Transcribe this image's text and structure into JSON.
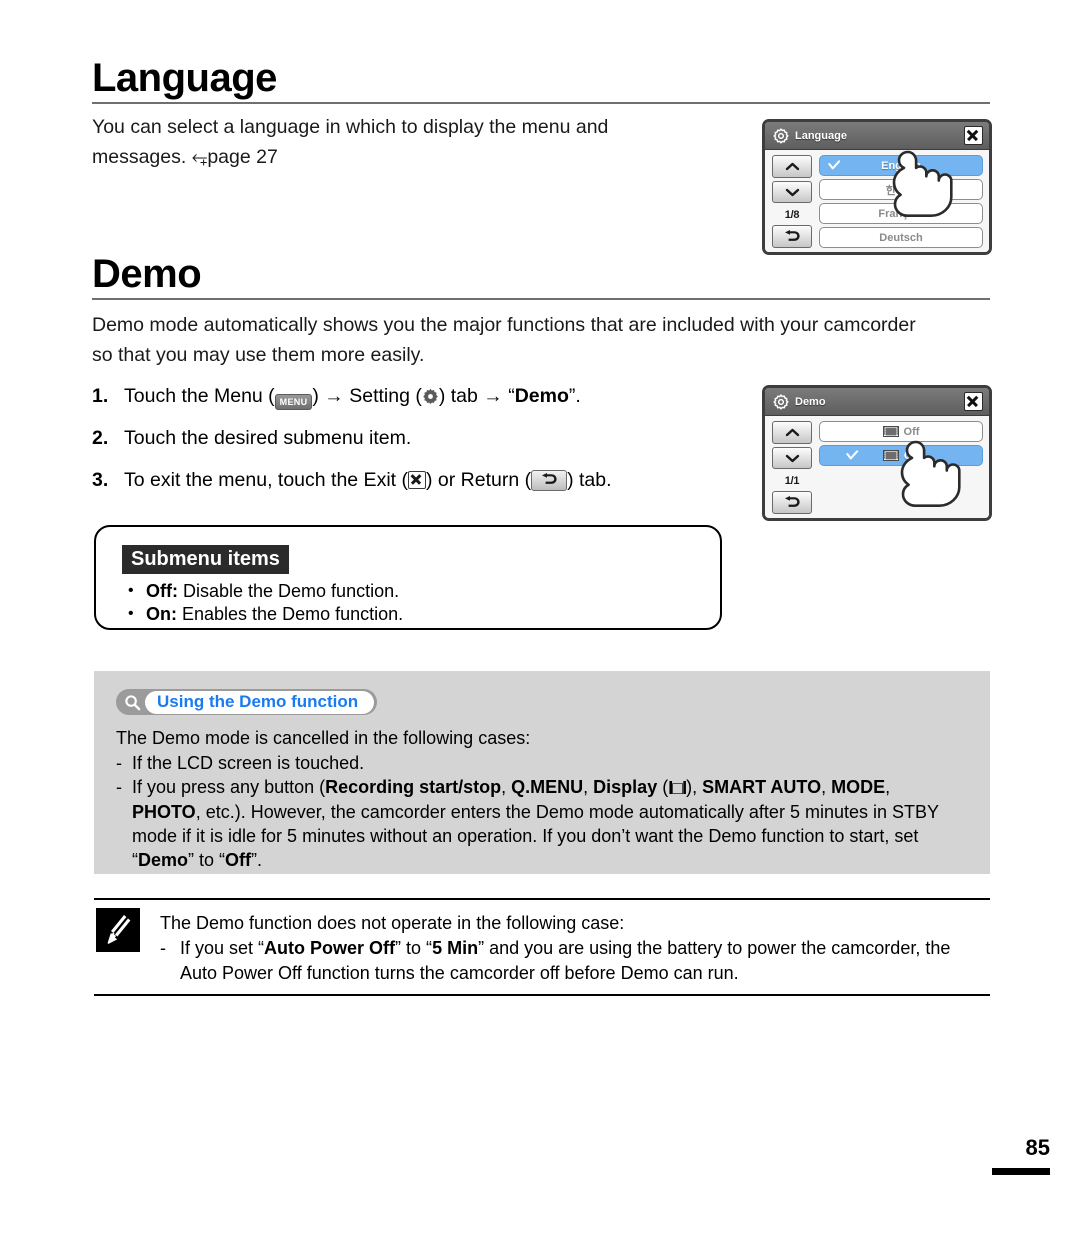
{
  "page": {
    "number": "85"
  },
  "sections": {
    "language": {
      "heading": "Language",
      "paragraph_1": "You can select a language in which to display the menu and",
      "paragraph_2_prefix": "messages. ",
      "paragraph_2_ref": "page 27"
    },
    "demo": {
      "heading": "Demo",
      "paragraph_1": "Demo mode automatically shows you the major functions that are included with your camcorder",
      "paragraph_2": "so that you may use them more easily."
    }
  },
  "steps": [
    {
      "num": "1.",
      "part_a": "Touch the Menu (",
      "menu_icon_label": "MENU",
      "part_b": ") ",
      "arrow_1": "→",
      "part_c": " Setting (",
      "part_d": ") tab ",
      "arrow_2": "→",
      "part_e": " “",
      "bold": "Demo",
      "part_f": "”."
    },
    {
      "num": "2.",
      "text": "Touch the desired submenu item."
    },
    {
      "num": "3.",
      "part_a": "To exit the menu, touch the Exit (",
      "part_b": ") or Return (",
      "part_c": ") tab."
    }
  ],
  "submenu_box": {
    "title": "Submenu items",
    "items": [
      {
        "term": "Off:",
        "desc": " Disable the Demo function."
      },
      {
        "term": "On:",
        "desc": " Enables the Demo function."
      }
    ]
  },
  "tip_box": {
    "badge_label": "Using the Demo function",
    "badge_icon": "magnifier-icon",
    "intro": "The Demo mode is cancelled in the following cases:",
    "dash": "-",
    "line_1": "If the LCD screen is touched.",
    "line_2_a": "If you press any button (",
    "line_2_b1": "Recording start/stop",
    "line_2_b2": ", ",
    "line_2_b3": "Q.MENU",
    "line_2_b4": ", ",
    "line_2_b5": "Display",
    "line_2_b6": " (",
    "line_2_display_icon": "I□I",
    "line_2_b7": "), ",
    "line_2_b8": "SMART AUTO",
    "line_2_b9": ", ",
    "line_2_b10": "MODE",
    "line_2_b11": ",",
    "line_3_a": "PHOTO",
    "line_3_b": ", etc.). However, the camcorder enters the Demo mode automatically after 5 minutes in STBY",
    "line_4": "mode if it is idle for 5 minutes without an operation. If you don’t want the Demo function to start, set",
    "line_5_a": "“",
    "line_5_b": "Demo",
    "line_5_c": "” to “",
    "line_5_d": "Off",
    "line_5_e": "”."
  },
  "note_box": {
    "icon": "note-pencil-icon",
    "intro": "The Demo function does not operate in the following case:",
    "dash": "-",
    "line_1_a": "If you set “",
    "line_1_b": "Auto Power Off",
    "line_1_c": "” to “",
    "line_1_d": "5 Min",
    "line_1_e": "” and you are using the battery to power the camcorder, the",
    "line_2": "Auto Power Off function turns the camcorder off before Demo can run."
  },
  "lcd_language": {
    "title": "Language",
    "gear_icon": "gear-icon",
    "close_icon": "close-icon",
    "up_icon": "chevron-up-icon",
    "down_icon": "chevron-down-icon",
    "return_icon": "return-arrow-icon",
    "page_indicator": "1/8",
    "items": [
      {
        "label": "English",
        "selected": true
      },
      {
        "label": "한국어",
        "selected": false
      },
      {
        "label": "Français",
        "selected": false
      },
      {
        "label": "Deutsch",
        "selected": false
      }
    ]
  },
  "lcd_demo": {
    "title": "Demo",
    "gear_icon": "gear-icon",
    "close_icon": "close-icon",
    "up_icon": "chevron-up-icon",
    "down_icon": "chevron-down-icon",
    "return_icon": "return-arrow-icon",
    "page_indicator": "1/1",
    "items": [
      {
        "label": "Off",
        "selected": false,
        "icon": "film-strip-icon"
      },
      {
        "label": "On",
        "selected": true,
        "icon": "film-strip-icon"
      }
    ]
  },
  "colors": {
    "selected_row": "#74b4f0",
    "tip_box_bg": "#d4d4d4",
    "badge_text": "#1a7bf0",
    "rule": "#6f6f6f"
  }
}
